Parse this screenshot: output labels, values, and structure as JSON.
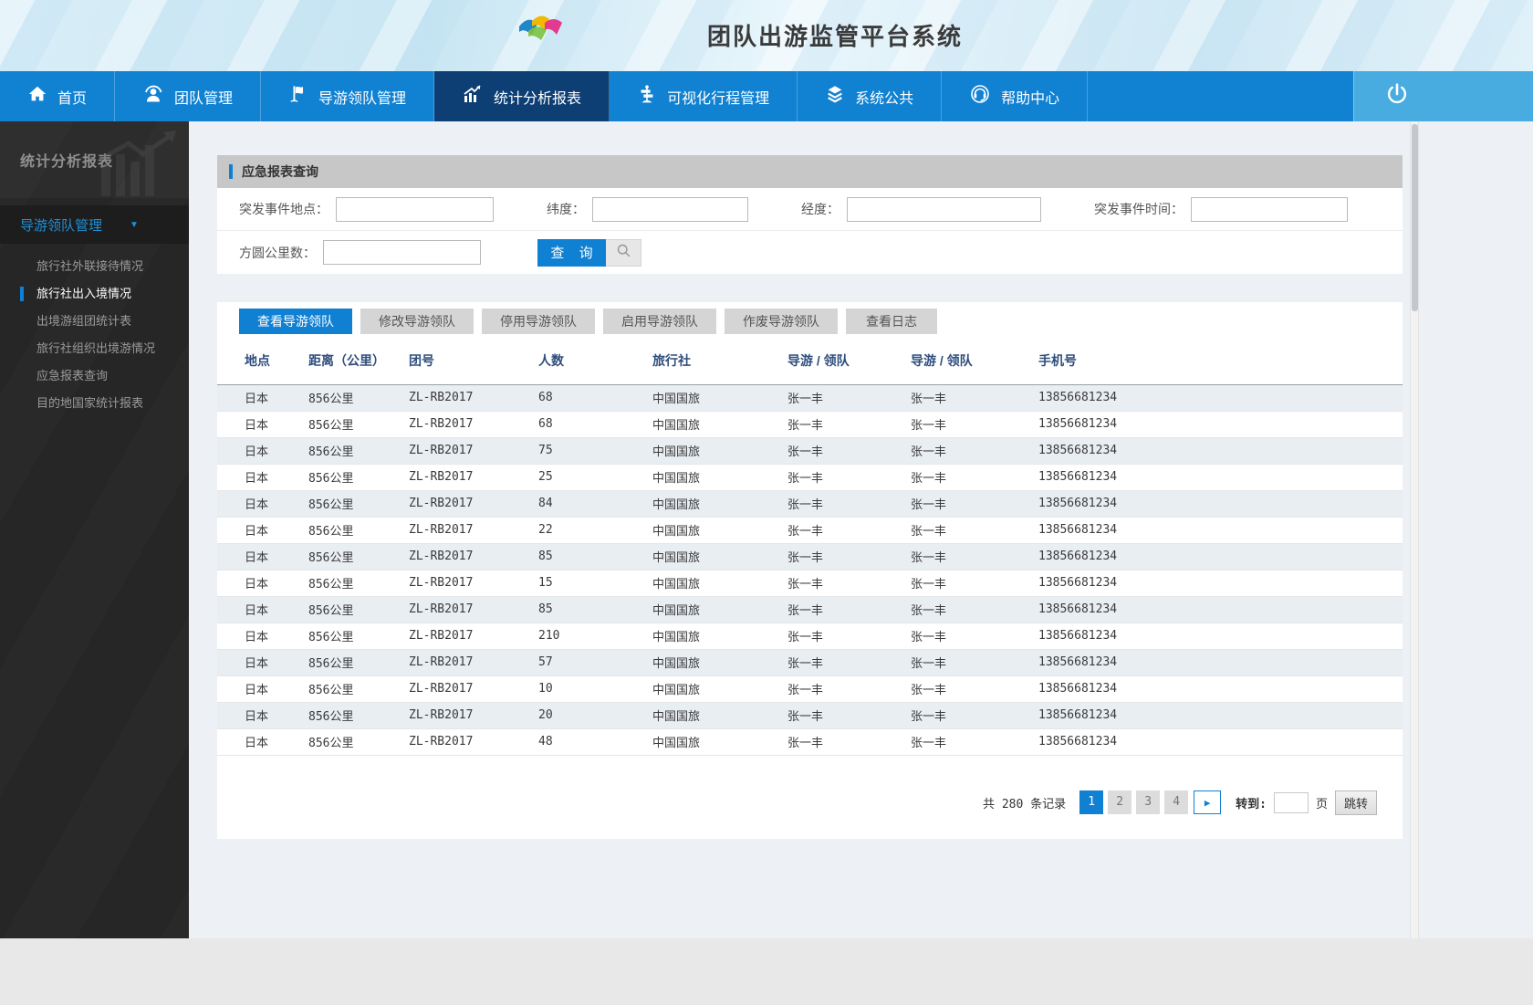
{
  "header": {
    "title": "团队出游监管平台系统",
    "logo": "ribbon-logo"
  },
  "nav": {
    "items": [
      {
        "label": "首页",
        "icon": "home-icon",
        "active": false
      },
      {
        "label": "团队管理",
        "icon": "team-icon",
        "active": false
      },
      {
        "label": "导游领队管理",
        "icon": "guide-flag-icon",
        "active": false
      },
      {
        "label": "统计分析报表",
        "icon": "stats-chart-icon",
        "active": true
      },
      {
        "label": "可视化行程管理",
        "icon": "signpost-icon",
        "active": false
      },
      {
        "label": "系统公共",
        "icon": "layers-icon",
        "active": false
      },
      {
        "label": "帮助中心",
        "icon": "headset-icon",
        "active": false
      }
    ],
    "power": {
      "icon": "power-icon"
    }
  },
  "sidebar": {
    "title": "统计分析报表",
    "section": {
      "label": "导游领队管理",
      "expanded": true,
      "icon": "caret-down-icon"
    },
    "items": [
      {
        "label": "旅行社外联接待情况",
        "active": false
      },
      {
        "label": "旅行社出入境情况",
        "active": true
      },
      {
        "label": "出境游组团统计表",
        "active": false
      },
      {
        "label": "旅行社组织出境游情况",
        "active": false
      },
      {
        "label": "应急报表查询",
        "active": false
      },
      {
        "label": "目的地国家统计报表",
        "active": false
      }
    ]
  },
  "panel": {
    "title": "应急报表查询",
    "form": {
      "fields": [
        {
          "label": "突发事件地点：",
          "value": ""
        },
        {
          "label": "纬度：",
          "value": ""
        },
        {
          "label": "经度：",
          "value": ""
        },
        {
          "label": "突发事件时间：",
          "value": ""
        },
        {
          "label": "方圆公里数：",
          "value": ""
        }
      ],
      "search_button": "查 询",
      "search_icon": "magnifier-icon"
    },
    "tabs": [
      {
        "label": "查看导游领队",
        "active": true
      },
      {
        "label": "修改导游领队",
        "active": false
      },
      {
        "label": "停用导游领队",
        "active": false
      },
      {
        "label": "启用导游领队",
        "active": false
      },
      {
        "label": "作废导游领队",
        "active": false
      },
      {
        "label": "查看日志",
        "active": false
      }
    ],
    "table": {
      "columns": [
        "地点",
        "距离（公里）",
        "团号",
        "人数",
        "旅行社",
        "导游 / 领队",
        "导游 / 领队",
        "手机号"
      ],
      "rows": [
        [
          "日本",
          "856公里",
          "ZL-RB2017",
          "68",
          "中国国旅",
          "张一丰",
          "张一丰",
          "13856681234"
        ],
        [
          "日本",
          "856公里",
          "ZL-RB2017",
          "68",
          "中国国旅",
          "张一丰",
          "张一丰",
          "13856681234"
        ],
        [
          "日本",
          "856公里",
          "ZL-RB2017",
          "75",
          "中国国旅",
          "张一丰",
          "张一丰",
          "13856681234"
        ],
        [
          "日本",
          "856公里",
          "ZL-RB2017",
          "25",
          "中国国旅",
          "张一丰",
          "张一丰",
          "13856681234"
        ],
        [
          "日本",
          "856公里",
          "ZL-RB2017",
          "84",
          "中国国旅",
          "张一丰",
          "张一丰",
          "13856681234"
        ],
        [
          "日本",
          "856公里",
          "ZL-RB2017",
          "22",
          "中国国旅",
          "张一丰",
          "张一丰",
          "13856681234"
        ],
        [
          "日本",
          "856公里",
          "ZL-RB2017",
          "85",
          "中国国旅",
          "张一丰",
          "张一丰",
          "13856681234"
        ],
        [
          "日本",
          "856公里",
          "ZL-RB2017",
          "15",
          "中国国旅",
          "张一丰",
          "张一丰",
          "13856681234"
        ],
        [
          "日本",
          "856公里",
          "ZL-RB2017",
          "85",
          "中国国旅",
          "张一丰",
          "张一丰",
          "13856681234"
        ],
        [
          "日本",
          "856公里",
          "ZL-RB2017",
          "210",
          "中国国旅",
          "张一丰",
          "张一丰",
          "13856681234"
        ],
        [
          "日本",
          "856公里",
          "ZL-RB2017",
          "57",
          "中国国旅",
          "张一丰",
          "张一丰",
          "13856681234"
        ],
        [
          "日本",
          "856公里",
          "ZL-RB2017",
          "10",
          "中国国旅",
          "张一丰",
          "张一丰",
          "13856681234"
        ],
        [
          "日本",
          "856公里",
          "ZL-RB2017",
          "20",
          "中国国旅",
          "张一丰",
          "张一丰",
          "13856681234"
        ],
        [
          "日本",
          "856公里",
          "ZL-RB2017",
          "48",
          "中国国旅",
          "张一丰",
          "张一丰",
          "13856681234"
        ]
      ]
    },
    "pagination": {
      "total_text": "共 280 条记录",
      "pages": [
        "1",
        "2",
        "3",
        "4"
      ],
      "active_page": "1",
      "next_icon": "next-arrow-icon",
      "goto_label": "转到:",
      "goto_value": "",
      "page_unit": "页",
      "jump_button": "跳转"
    }
  },
  "colors": {
    "accent_blue": "#1080d3",
    "nav_bar": "#1181d2",
    "nav_active": "#0d3e74",
    "power_section": "#49ace0",
    "sidebar_bg": "#262626",
    "sidebar_link": "#1e8fd5",
    "table_header_text": "#2f4e7d",
    "row_alternate": "#e9eef3",
    "titlebar_gray": "#c7c7c7"
  }
}
